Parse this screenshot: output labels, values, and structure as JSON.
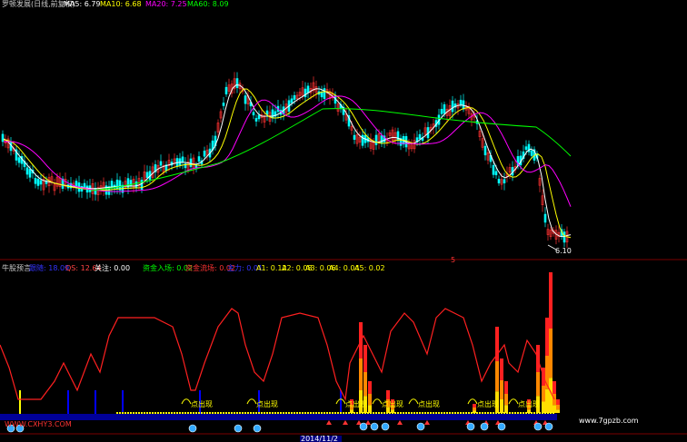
{
  "header_top": {
    "name": "罗顿发展(日线,前复权)",
    "ma5": "MA5: 6.79",
    "ma10": "MA10: 6.68",
    "ma20": "MA20: 7.25",
    "ma60": "MA60: 8.09"
  },
  "header_bottom": {
    "title": "牛股预言",
    "a": "跟随: 18.09",
    "b": "QS: 12.64",
    "c": "关注: 0.00",
    "d": "资金入场: 0.02",
    "e": "资金流场: 0.02",
    "f": "主力: 0.01",
    "a1": "A1: 0.12",
    "a2": "A2: 0.08",
    "a3": "A3: 0.06",
    "a4": "A4: 0.04",
    "a5": "A5: 0.02"
  },
  "low_label": "6.10",
  "marker_label": "点出现",
  "watermark_left": "WWW.CXHY3.COM",
  "watermark_right": "www.7gpzb.com",
  "axis_labels": [
    "2014/11/2"
  ],
  "colors": {
    "ma5": "#ffffff",
    "ma10": "#ffff00",
    "ma20": "#ff00ff",
    "ma60": "#00ff00",
    "up": "#ff3333",
    "down": "#00ffff",
    "osc": "#ff2020",
    "base": "#0000ff",
    "marker": "#ffff00"
  },
  "chart_data": {
    "type": "line",
    "title": "罗顿发展(日线,前复权)",
    "xlabel": "",
    "ylabel": "",
    "series": [
      {
        "name": "MA5",
        "values": []
      },
      {
        "name": "MA10",
        "values": []
      },
      {
        "name": "MA20",
        "values": []
      },
      {
        "name": "MA60",
        "values": []
      }
    ],
    "annotations": [
      "6.10"
    ]
  }
}
